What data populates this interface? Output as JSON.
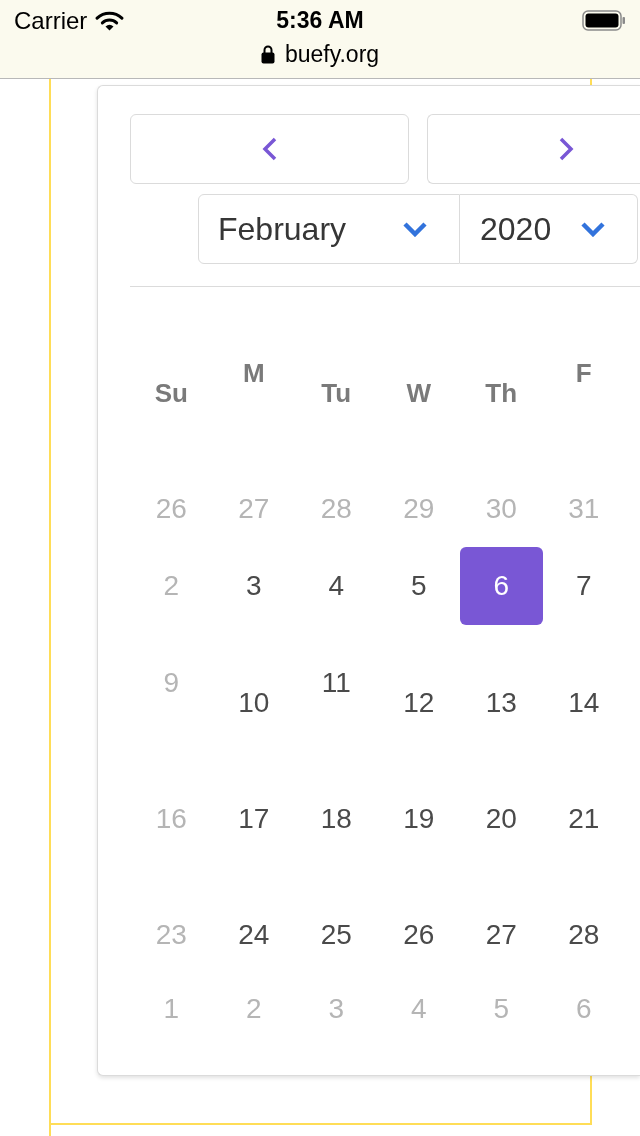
{
  "status_bar": {
    "carrier": "Carrier",
    "time": "5:36 AM"
  },
  "address_bar": {
    "url": "buefy.org"
  },
  "datepicker": {
    "month": "February",
    "year": "2020",
    "weekdays": [
      "Su",
      "M",
      "Tu",
      "W",
      "Th",
      "F"
    ],
    "weeks": [
      [
        {
          "day": "26",
          "disabled": true,
          "selected": false
        },
        {
          "day": "27",
          "disabled": true,
          "selected": false
        },
        {
          "day": "28",
          "disabled": true,
          "selected": false
        },
        {
          "day": "29",
          "disabled": true,
          "selected": false
        },
        {
          "day": "30",
          "disabled": true,
          "selected": false
        },
        {
          "day": "31",
          "disabled": true,
          "selected": false
        }
      ],
      [
        {
          "day": "2",
          "disabled": true,
          "selected": false
        },
        {
          "day": "3",
          "disabled": false,
          "selected": false
        },
        {
          "day": "4",
          "disabled": false,
          "selected": false
        },
        {
          "day": "5",
          "disabled": false,
          "selected": false
        },
        {
          "day": "6",
          "disabled": false,
          "selected": true
        },
        {
          "day": "7",
          "disabled": false,
          "selected": false
        }
      ],
      [
        {
          "day": "9",
          "disabled": true,
          "selected": false
        },
        {
          "day": "10",
          "disabled": false,
          "selected": false
        },
        {
          "day": "11",
          "disabled": false,
          "selected": false
        },
        {
          "day": "12",
          "disabled": false,
          "selected": false
        },
        {
          "day": "13",
          "disabled": false,
          "selected": false
        },
        {
          "day": "14",
          "disabled": false,
          "selected": false
        }
      ],
      [
        {
          "day": "16",
          "disabled": true,
          "selected": false
        },
        {
          "day": "17",
          "disabled": false,
          "selected": false
        },
        {
          "day": "18",
          "disabled": false,
          "selected": false
        },
        {
          "day": "19",
          "disabled": false,
          "selected": false
        },
        {
          "day": "20",
          "disabled": false,
          "selected": false
        },
        {
          "day": "21",
          "disabled": false,
          "selected": false
        }
      ],
      [
        {
          "day": "23",
          "disabled": true,
          "selected": false
        },
        {
          "day": "24",
          "disabled": false,
          "selected": false
        },
        {
          "day": "25",
          "disabled": false,
          "selected": false
        },
        {
          "day": "26",
          "disabled": false,
          "selected": false
        },
        {
          "day": "27",
          "disabled": false,
          "selected": false
        },
        {
          "day": "28",
          "disabled": false,
          "selected": false
        }
      ],
      [
        {
          "day": "1",
          "disabled": true,
          "selected": false
        },
        {
          "day": "2",
          "disabled": true,
          "selected": false
        },
        {
          "day": "3",
          "disabled": true,
          "selected": false
        },
        {
          "day": "4",
          "disabled": true,
          "selected": false
        },
        {
          "day": "5",
          "disabled": true,
          "selected": false
        },
        {
          "day": "6",
          "disabled": true,
          "selected": false
        }
      ]
    ]
  }
}
